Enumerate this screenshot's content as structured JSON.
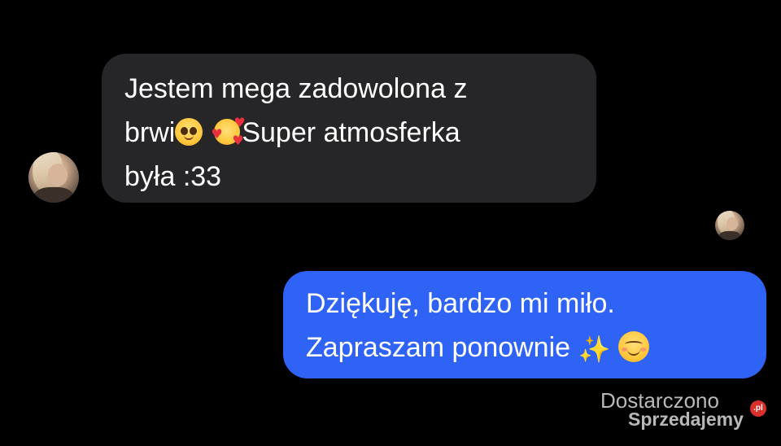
{
  "conversation": {
    "incoming_message": {
      "line1": "Jestem mega zadowolona z",
      "line2_before": "brwi",
      "line2_after": "Super atmosferka",
      "line3": "była :33",
      "emoji_1": "pleading-face",
      "emoji_2": "smiling-face-with-hearts",
      "bubble_color": "#262628"
    },
    "outgoing_message": {
      "line1": "Dziękuję, bardzo mi miło.",
      "line2": "Zapraszam ponownie",
      "emoji_1": "sparkles",
      "emoji_2": "smiling-face",
      "bubble_color": "#2f63f5"
    }
  },
  "watermark": {
    "line1": "Dostarczono",
    "line2": "Sprzedajemy",
    "badge": ".pl"
  },
  "colors": {
    "background": "#000000",
    "text": "#ffffff"
  }
}
